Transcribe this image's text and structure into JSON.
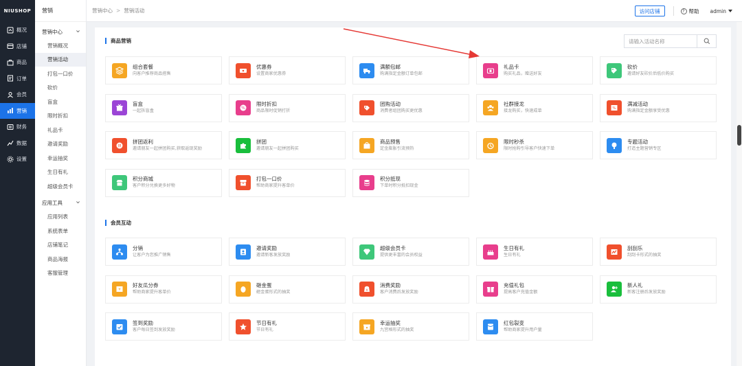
{
  "rail": {
    "logo": "NIUSHOP",
    "items": [
      {
        "label": "概况",
        "icon": "dashboard-icon"
      },
      {
        "label": "店铺",
        "icon": "store-icon"
      },
      {
        "label": "商品",
        "icon": "goods-icon"
      },
      {
        "label": "订单",
        "icon": "order-icon"
      },
      {
        "label": "会员",
        "icon": "member-icon"
      },
      {
        "label": "营销",
        "icon": "marketing-icon"
      },
      {
        "label": "财务",
        "icon": "finance-icon"
      },
      {
        "label": "数据",
        "icon": "data-icon"
      },
      {
        "label": "设置",
        "icon": "settings-icon"
      }
    ]
  },
  "sub": {
    "title": "营销",
    "group1": "营销中心",
    "group1_items": [
      "营销概况",
      "营销活动",
      "打包一口价",
      "砍价",
      "盲盒",
      "限时折扣",
      "礼品卡",
      "邀请奖励",
      "幸运抽奖",
      "生日有礼",
      "超级会员卡"
    ],
    "group2": "应用工具",
    "group2_items": [
      "应用列表",
      "系统表单",
      "店铺笔记",
      "商品海报",
      "客服管理"
    ]
  },
  "header": {
    "breadcrumb_1": "营销中心",
    "breadcrumb_sep": ">",
    "breadcrumb_2": "营销活动",
    "visit_store": "访问店铺",
    "help": "帮助",
    "user": "admin"
  },
  "search": {
    "placeholder": "请输入活动名称"
  },
  "sections": [
    {
      "title": "商品营销"
    },
    {
      "title": "会员互动"
    }
  ],
  "goods_cards": [
    {
      "name": "组合套餐",
      "desc": "向客户推荐商品搭售",
      "color": "#f5a623",
      "icon": "layers-icon"
    },
    {
      "name": "优惠券",
      "desc": "设置商家优惠券",
      "color": "#f0502d",
      "icon": "coupon-icon"
    },
    {
      "name": "满额包邮",
      "desc": "购满指定金额订单包邮",
      "color": "#2d8cf0",
      "icon": "truck-icon"
    },
    {
      "name": "礼品卡",
      "desc": "购买礼品，赠送好友",
      "color": "#e83e8c",
      "icon": "gift-card-icon"
    },
    {
      "name": "砍价",
      "desc": "邀请好友砍价后低价购买",
      "color": "#3ec77a",
      "icon": "bargain-icon"
    },
    {
      "name": "盲盒",
      "desc": "一起拆盲盒",
      "color": "#9b45d6",
      "icon": "blind-box-icon"
    },
    {
      "name": "限时折扣",
      "desc": "商品限时促销打折",
      "color": "#e83e8c",
      "icon": "discount-icon"
    },
    {
      "name": "团购活动",
      "desc": "消费者组团购买更优惠",
      "color": "#f0502d",
      "icon": "group-buy-icon"
    },
    {
      "name": "社群接龙",
      "desc": "接龙购买，快速成单",
      "color": "#f5a623",
      "icon": "community-icon"
    },
    {
      "name": "满减活动",
      "desc": "购满指定金额享受优惠",
      "color": "#f0502d",
      "icon": "full-reduce-icon"
    },
    {
      "name": "拼团返利",
      "desc": "邀请朋友一起拼团购买,获取返现奖励",
      "color": "#f0502d",
      "icon": "pintuan-rebate-icon"
    },
    {
      "name": "拼团",
      "desc": "邀请朋友一起拼团购买",
      "color": "#19be3c",
      "icon": "puzzle-icon"
    },
    {
      "name": "商品预售",
      "desc": "定金膨胀引流预热",
      "color": "#f5a623",
      "icon": "presale-icon"
    },
    {
      "name": "限时秒杀",
      "desc": "限时抢购引导客户快速下单",
      "color": "#f5a623",
      "icon": "seckill-icon"
    },
    {
      "name": "专题活动",
      "desc": "打造主题营销专区",
      "color": "#2d8cf0",
      "icon": "topic-icon"
    },
    {
      "name": "积分商城",
      "desc": "客户积分兑换更多好物",
      "color": "#3ec77a",
      "icon": "points-mall-icon"
    },
    {
      "name": "打包一口价",
      "desc": "帮助商家提升客单价",
      "color": "#f0502d",
      "icon": "bundle-icon"
    },
    {
      "name": "积分抵现",
      "desc": "下单时积分抵扣现金",
      "color": "#e83e8c",
      "icon": "points-cash-icon"
    }
  ],
  "member_cards": [
    {
      "name": "分销",
      "desc": "让客户为您推广销售",
      "color": "#2d8cf0",
      "icon": "distribution-icon"
    },
    {
      "name": "邀请奖励",
      "desc": "邀请新客发放奖励",
      "color": "#2d8cf0",
      "icon": "invite-icon"
    },
    {
      "name": "超级会员卡",
      "desc": "提供更丰富的会员权益",
      "color": "#3ec77a",
      "icon": "vip-card-icon"
    },
    {
      "name": "生日有礼",
      "desc": "生日有礼",
      "color": "#e83e8c",
      "icon": "birthday-icon"
    },
    {
      "name": "刮刮乐",
      "desc": "刮刮卡形式的抽奖",
      "color": "#f0502d",
      "icon": "scratch-icon"
    },
    {
      "name": "好友瓜分券",
      "desc": "帮助商家提升客单价",
      "color": "#f5a623",
      "icon": "share-coupon-icon"
    },
    {
      "name": "砸金蛋",
      "desc": "砸金蛋形式的抽奖",
      "color": "#f5a623",
      "icon": "golden-egg-icon"
    },
    {
      "name": "消费奖励",
      "desc": "客户消费后发放奖励",
      "color": "#f0502d",
      "icon": "consume-reward-icon"
    },
    {
      "name": "充值礼包",
      "desc": "提高客户充值金额",
      "color": "#e83e8c",
      "icon": "recharge-gift-icon"
    },
    {
      "name": "新人礼",
      "desc": "新客注册后发放奖励",
      "color": "#19be3c",
      "icon": "newcomer-icon"
    },
    {
      "name": "签到奖励",
      "desc": "客户每日签到发放奖励",
      "color": "#2d8cf0",
      "icon": "signin-icon"
    },
    {
      "name": "节日有礼",
      "desc": "节日有礼",
      "color": "#f0502d",
      "icon": "festival-icon"
    },
    {
      "name": "幸运抽奖",
      "desc": "九宫格形式的抽奖",
      "color": "#f5a623",
      "icon": "lottery-icon"
    },
    {
      "name": "红包裂变",
      "desc": "帮助商家提升用户量",
      "color": "#2d8cf0",
      "icon": "red-packet-icon"
    }
  ]
}
